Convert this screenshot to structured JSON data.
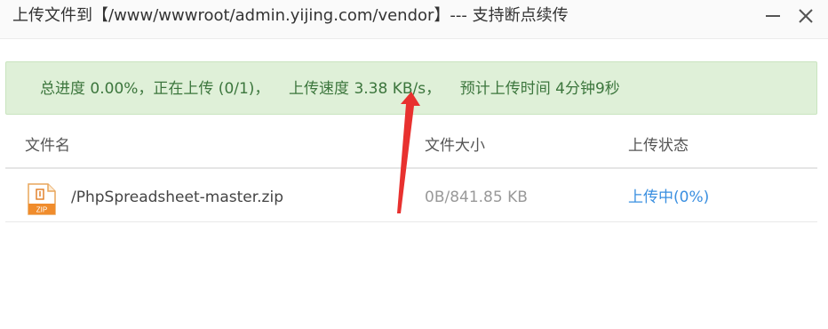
{
  "window": {
    "title": "上传文件到【/www/wwwroot/admin.yijing.com/vendor】--- 支持断点续传",
    "minimize_icon": "minimize-icon",
    "close_icon": "close-icon"
  },
  "progress": {
    "text": "总进度 0.00%，正在上传 (0/1)，    上传速度 3.38 KB/s，    预计上传时间 4分钟9秒",
    "background_color": "#dff0d8",
    "text_color": "#3c763d"
  },
  "table": {
    "headers": [
      "文件名",
      "文件大小",
      "上传状态"
    ],
    "rows": [
      {
        "icon": "zip-file-icon",
        "icon_label": "ZIP",
        "name": "/PhpSpreadsheet-master.zip",
        "size": "0B/841.85 KB",
        "status": "上传中(0%)"
      }
    ]
  },
  "annotation": {
    "arrow_color": "#e8312f"
  }
}
